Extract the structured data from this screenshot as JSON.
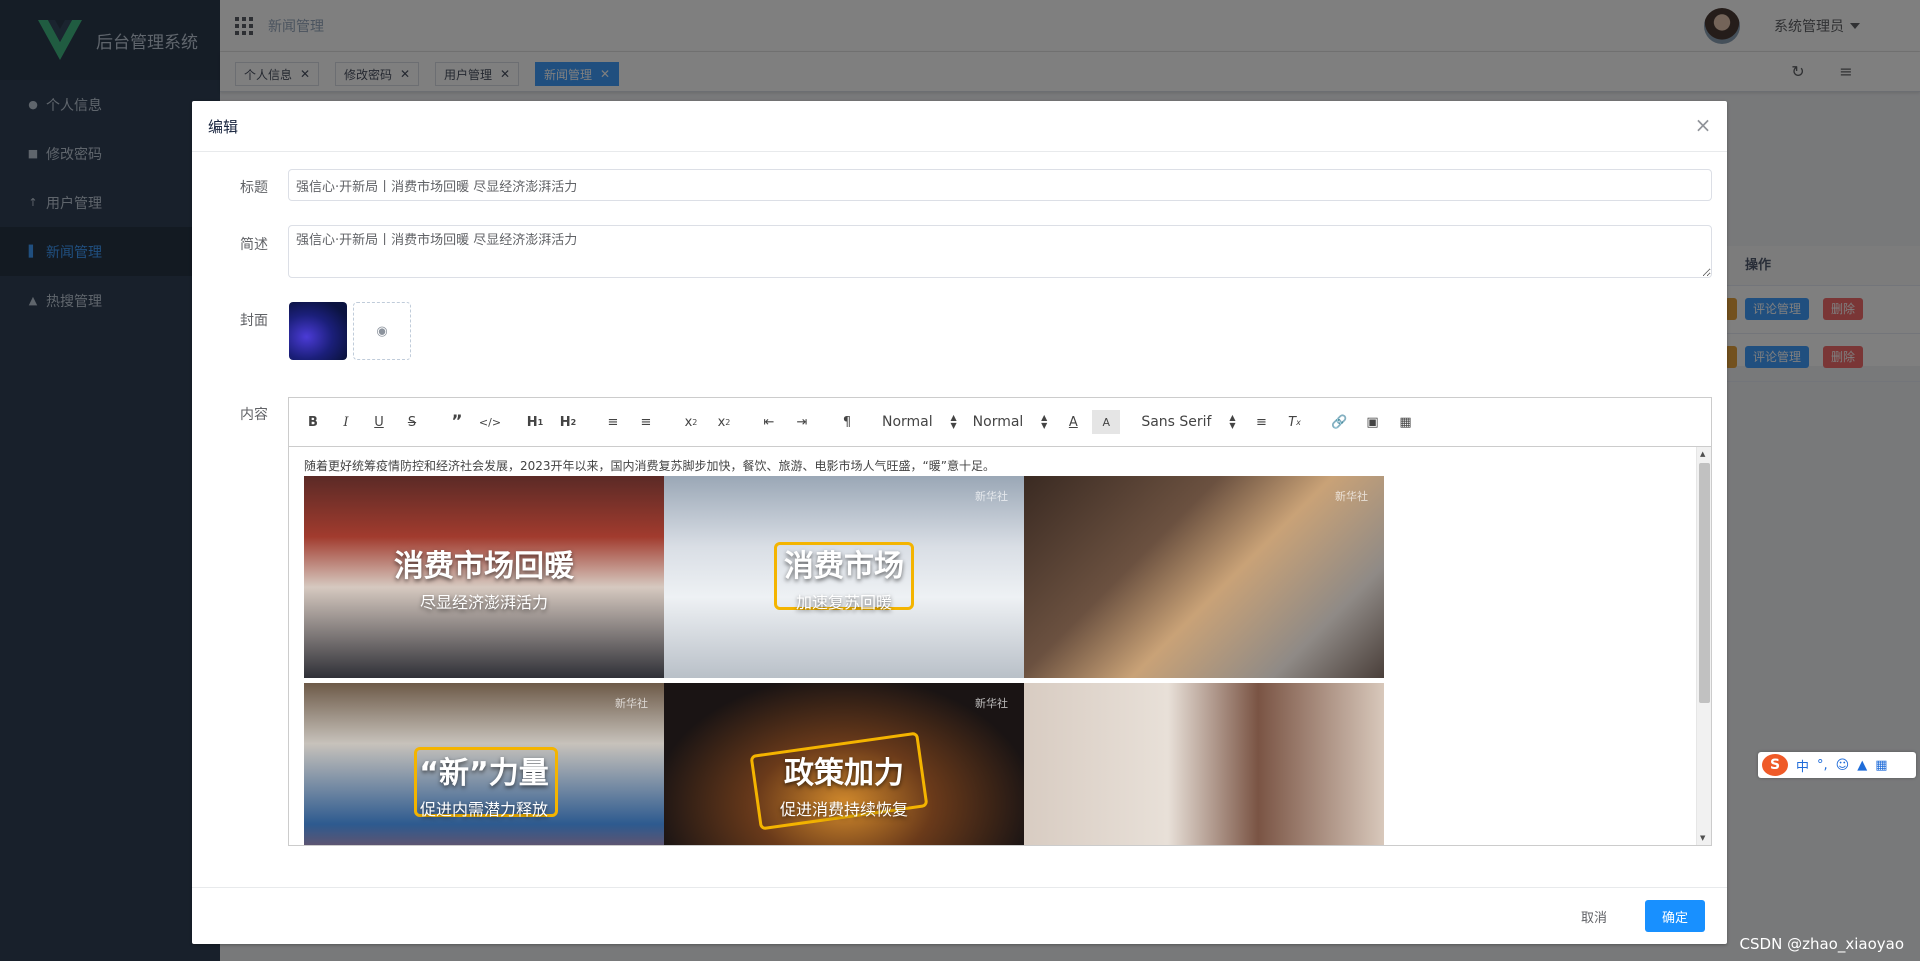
{
  "app": {
    "title": "后台管理系统",
    "logo_icon": "vue-logo-icon"
  },
  "sidebar": {
    "items": [
      {
        "label": "个人信息",
        "icon": "user-icon",
        "active": false
      },
      {
        "label": "修改密码",
        "icon": "lock-icon",
        "active": false
      },
      {
        "label": "用户管理",
        "icon": "pin-icon",
        "active": false
      },
      {
        "label": "新闻管理",
        "icon": "chart-icon",
        "active": true
      },
      {
        "label": "热搜管理",
        "icon": "fire-icon",
        "active": false
      }
    ]
  },
  "header": {
    "breadcrumb": "新闻管理",
    "user_name": "系统管理员"
  },
  "tags": [
    {
      "label": "个人信息",
      "active": false
    },
    {
      "label": "修改密码",
      "active": false
    },
    {
      "label": "用户管理",
      "active": false
    },
    {
      "label": "新闻管理",
      "active": true
    }
  ],
  "table": {
    "op_header": "操作",
    "rows": [
      {
        "comment_label": "评论管理",
        "delete_label": "删除"
      },
      {
        "comment_label": "评论管理",
        "delete_label": "删除"
      }
    ]
  },
  "dialog": {
    "title": "编辑",
    "labels": {
      "title": "标题",
      "summary": "简述",
      "cover": "封面",
      "content": "内容"
    },
    "title_value": "强信心·开新局丨消费市场回暖 尽显经济澎湃活力",
    "summary_value": "强信心·开新局丨消费市场回暖 尽显经济澎湃活力",
    "editor": {
      "header_picker": "Normal",
      "size_picker": "Normal",
      "font_picker": "Sans Serif",
      "text": "随着更好统筹疫情防控和经济社会发展，2023开年以来，国内消费复苏脚步加快，餐饮、旅游、电影市场人气旺盛，“暖”意十足。",
      "photos": [
        {
          "caption": "消费市场回暖",
          "subcaption": "尽显经济澎湃活力"
        },
        {
          "caption": "消费市场",
          "subcaption": "加速复苏回暖",
          "watermark": "新华社"
        },
        {
          "caption": "",
          "subcaption": "",
          "watermark": "新华社"
        },
        {
          "caption": "“新”力量",
          "subcaption": "促进内需潜力释放",
          "watermark": "新华社"
        },
        {
          "caption": "政策加力",
          "subcaption": "促进消费持续恢复",
          "watermark": "新华社"
        },
        {
          "caption": "",
          "subcaption": ""
        }
      ]
    },
    "cancel_label": "取消",
    "ok_label": "确定"
  },
  "ime": {
    "lang": "中",
    "punct": "°,"
  },
  "watermark": "CSDN @zhao_xiaoyao"
}
